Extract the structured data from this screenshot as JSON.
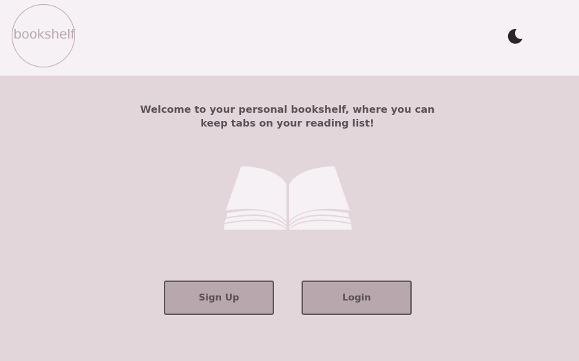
{
  "header": {
    "logo_text": "bookshelf",
    "theme_toggle_icon": "moon-icon"
  },
  "main": {
    "welcome_line1": "Welcome to your personal bookshelf, where you can",
    "welcome_line2": "keep tabs on your reading list!",
    "hero_icon": "open-book-icon",
    "signup_label": "Sign Up",
    "login_label": "Login"
  },
  "colors": {
    "header_bg": "#f5f1f4",
    "body_bg": "#e2d6db",
    "button_bg": "#b8a8ad",
    "button_border": "#5f565c",
    "text": "#5b5158",
    "logo": "#bba7b1",
    "book_illustration": "#f5f1f4"
  }
}
